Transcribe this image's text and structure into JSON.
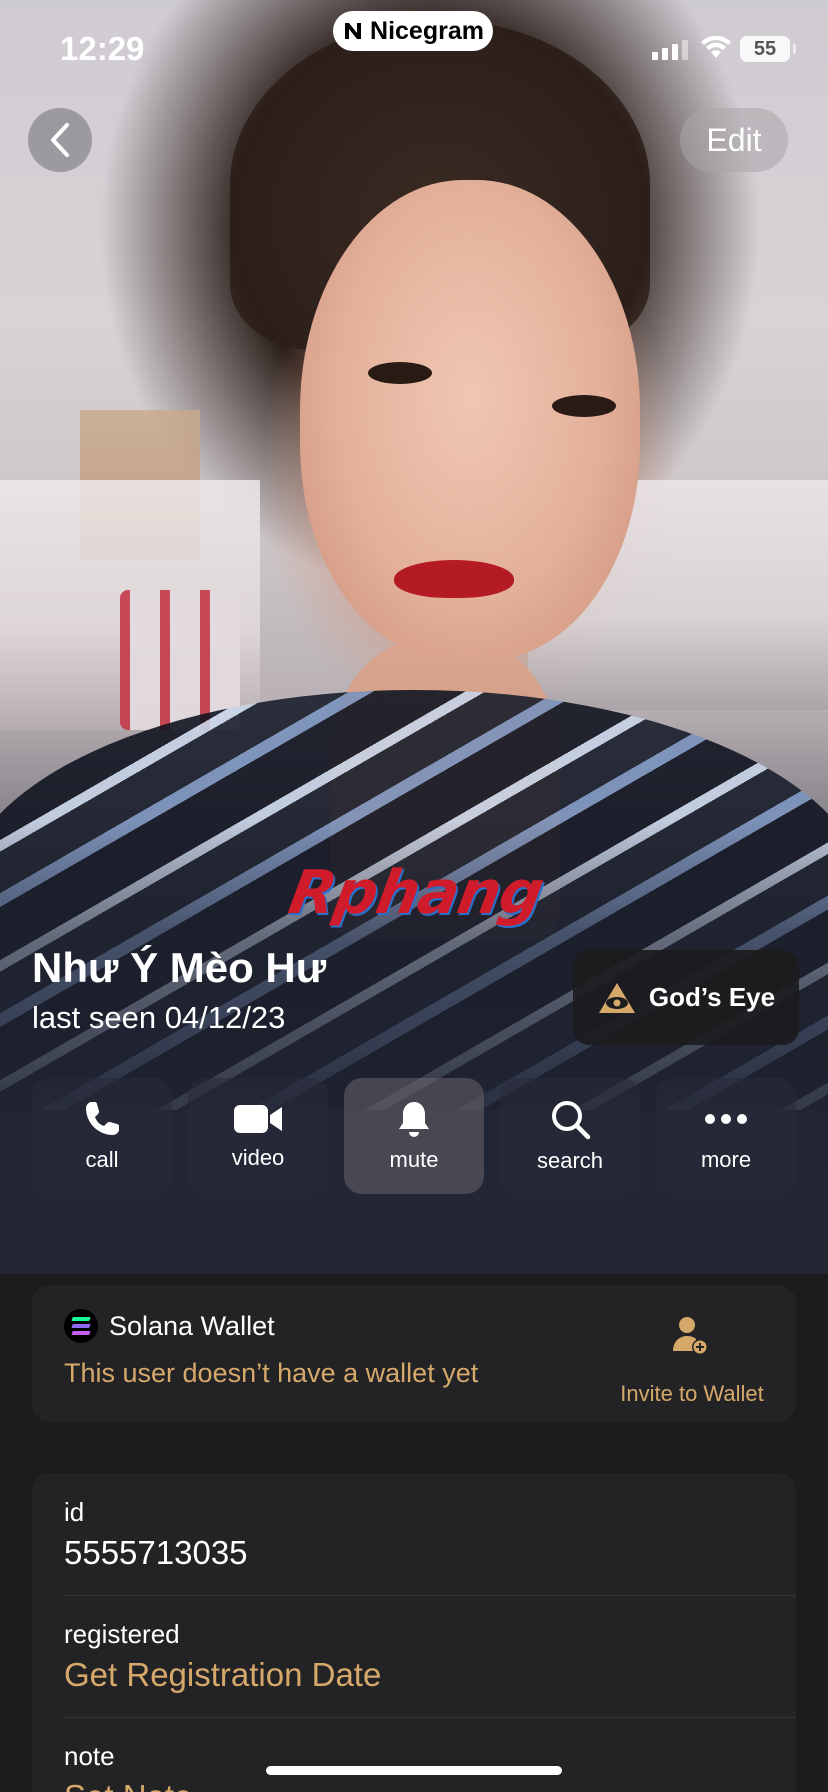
{
  "status_bar": {
    "time": "12:29",
    "app_badge": "Nicegram",
    "battery": "55"
  },
  "nav": {
    "edit_label": "Edit"
  },
  "watermark": "Rphang",
  "profile": {
    "name": "Như Ý Mèo Hư",
    "last_seen": "last seen 04/12/23",
    "gods_eye_label": "God’s Eye"
  },
  "actions": [
    {
      "label": "call",
      "icon": "phone-icon"
    },
    {
      "label": "video",
      "icon": "video-camera-icon"
    },
    {
      "label": "mute",
      "icon": "bell-icon"
    },
    {
      "label": "search",
      "icon": "search-icon"
    },
    {
      "label": "more",
      "icon": "more-dots-icon"
    }
  ],
  "wallet": {
    "title": "Solana Wallet",
    "message": "This user doesn’t have a wallet yet",
    "invite_label": "Invite to Wallet"
  },
  "info": {
    "id_label": "id",
    "id_value": "5555713035",
    "registered_label": "registered",
    "registered_value": "Get Registration Date",
    "note_label": "note",
    "note_value": "Set Note"
  },
  "colors": {
    "accent_gold": "#d6a96b",
    "background": "#1c1c1e",
    "card": "#232325"
  }
}
